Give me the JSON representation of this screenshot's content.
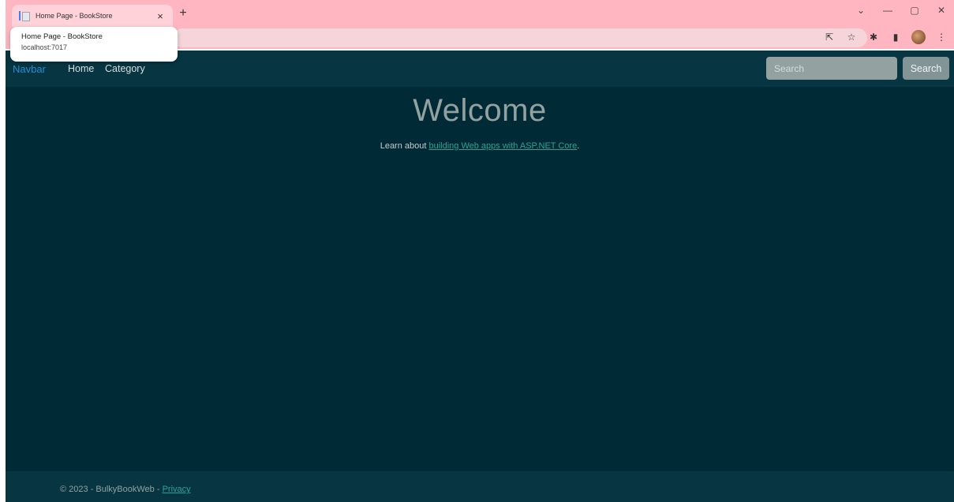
{
  "browser": {
    "tab_title": "Home Page - BookStore",
    "tab_close": "×",
    "new_tab": "+",
    "tooltip": {
      "title": "Home Page - BookStore",
      "url": "localhost:7017"
    },
    "window_controls": {
      "dropdown": "⌄",
      "minimize": "—",
      "restore": "▢",
      "close": "✕"
    },
    "toolbar_icons": {
      "share": "⇱",
      "star": "☆",
      "extensions": "✱",
      "sidepanel": "▮",
      "menu": "⋮"
    }
  },
  "navbar": {
    "brand": "Navbar",
    "links": [
      "Home",
      "Category"
    ],
    "search_placeholder": "Search",
    "search_button": "Search"
  },
  "hero": {
    "title": "Welcome",
    "text_prefix": "Learn about ",
    "link_text": "building Web apps with ASP.NET Core",
    "text_suffix": "."
  },
  "footer": {
    "text": "© 2023 - BulkyBookWeb - ",
    "link": "Privacy"
  },
  "colors": {
    "background": "#002b36",
    "navbar": "#073642",
    "brand": "#268bd2",
    "link": "#2aa198",
    "chrome": "#ffb6c1"
  }
}
